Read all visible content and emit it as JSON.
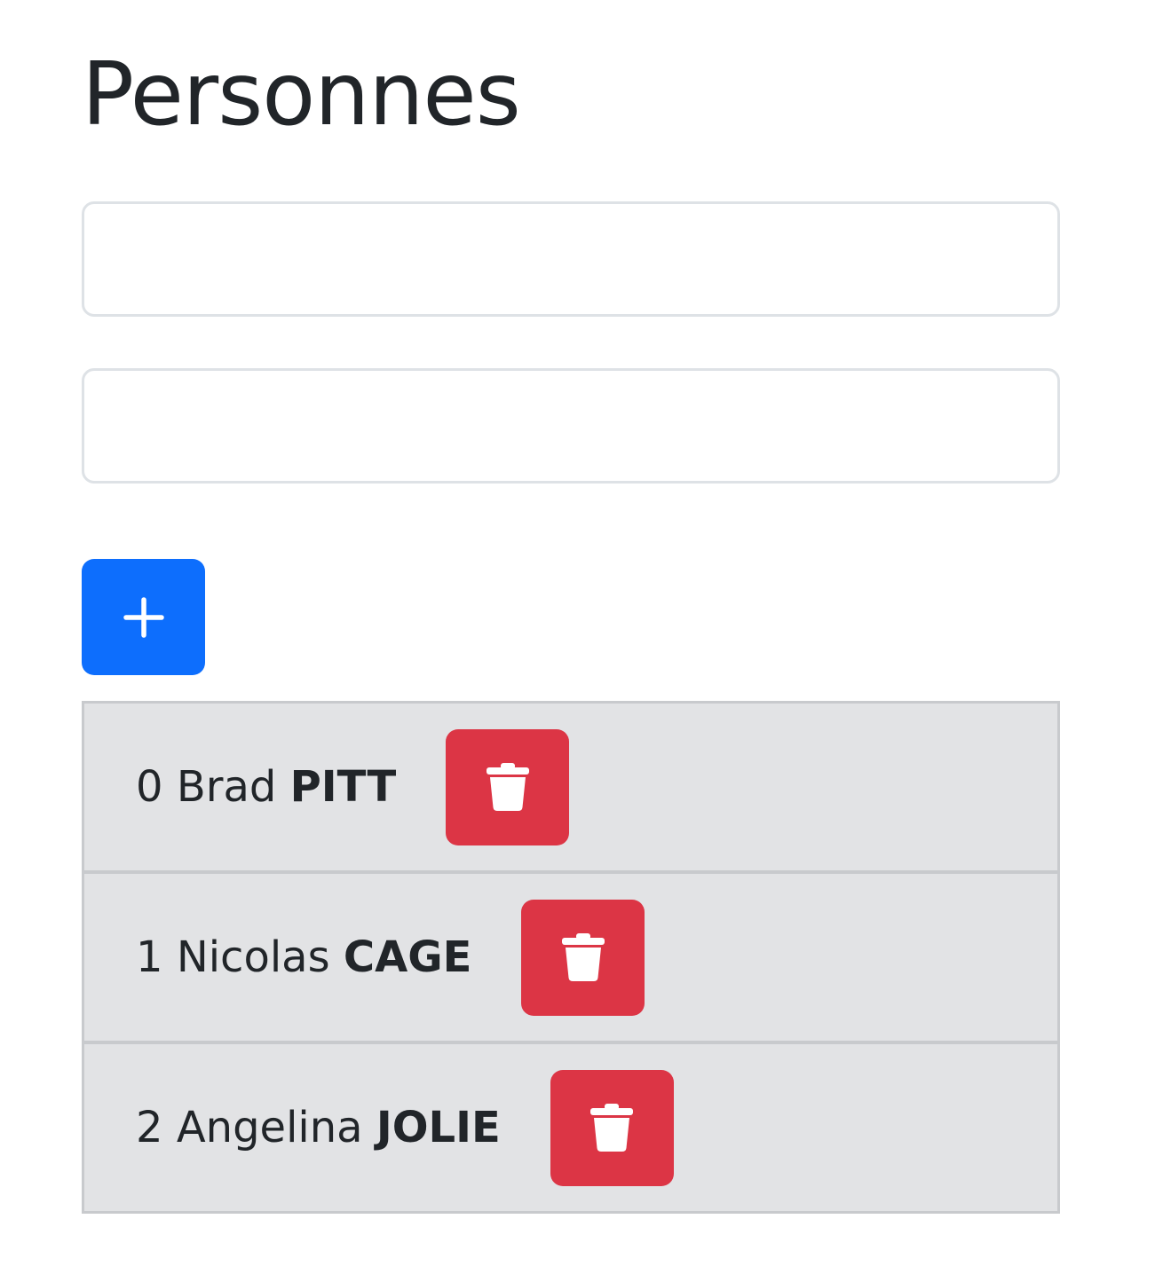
{
  "header": {
    "title": "Personnes"
  },
  "form": {
    "first_name": {
      "value": "",
      "placeholder": ""
    },
    "last_name": {
      "value": "",
      "placeholder": ""
    },
    "add_button_icon": "plus-icon"
  },
  "persons": [
    {
      "index": "0",
      "first": "Brad",
      "last": "PITT",
      "delete_icon": "trash-icon"
    },
    {
      "index": "1",
      "first": "Nicolas",
      "last": "CAGE",
      "delete_icon": "trash-icon"
    },
    {
      "index": "2",
      "first": "Angelina",
      "last": "JOLIE",
      "delete_icon": "trash-icon"
    }
  ],
  "colors": {
    "primary": "#0d6efd",
    "danger": "#dc3545",
    "list_background": "#e2e3e5",
    "text": "#212529"
  }
}
